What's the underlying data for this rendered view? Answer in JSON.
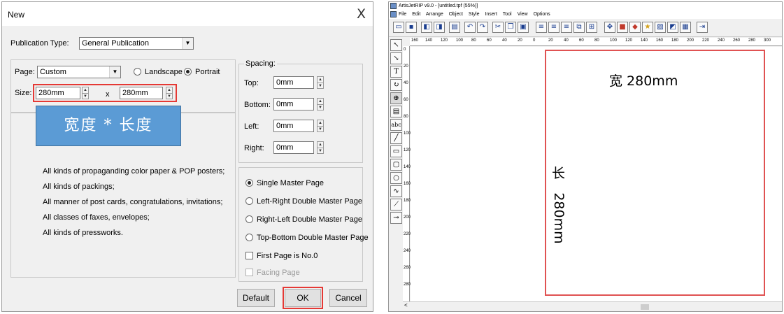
{
  "dialog": {
    "title": "New",
    "close_glyph": "X",
    "publication_type_label": "Publication Type:",
    "publication_type_value": "General Publication",
    "page_label": "Page:",
    "page_value": "Custom",
    "landscape_label": "Landscape",
    "portrait_label": "Portrait",
    "orientation_selected": "Portrait",
    "size_label": "Size:",
    "width_value": "280mm",
    "times": "x",
    "height_value": "280mm",
    "annotation": "宽度 * 长度",
    "spacing_title": "Spacing:",
    "spacing": [
      {
        "label": "Top:",
        "value": "0mm"
      },
      {
        "label": "Bottom:",
        "value": "0mm"
      },
      {
        "label": "Left:",
        "value": "0mm"
      },
      {
        "label": "Right:",
        "value": "0mm"
      }
    ],
    "descriptions": [
      "All kinds of propaganding color paper & POP posters;",
      "All kinds of packings;",
      "All manner of post cards, congratulations, invitations;",
      "All classes of faxes, envelopes;",
      "All kinds of pressworks."
    ],
    "master_options": [
      "Single Master Page",
      "Left-Right Double Master Page",
      "Right-Left Double Master Page",
      "Top-Bottom Double Master Page"
    ],
    "master_selected": "Single Master Page",
    "first_page_label": "First Page is No.0",
    "facing_page_label": "Facing Page",
    "default_button": "Default",
    "ok_button": "OK",
    "cancel_button": "Cancel",
    "highlight_color": "#e53935",
    "annotation_color": "#5b9bd5"
  },
  "app": {
    "title": "ArtisJetRIP v9.0 - [untitled.tpf (55%)]",
    "menu": [
      "File",
      "Edit",
      "Arrange",
      "Object",
      "Style",
      "Insert",
      "Tool",
      "View",
      "Options"
    ],
    "ruler_h": [
      "160",
      "140",
      "120",
      "100",
      "80",
      "60",
      "40",
      "20",
      "0",
      "20",
      "40",
      "60",
      "80",
      "100",
      "120",
      "140",
      "160",
      "180",
      "200",
      "220",
      "240",
      "260",
      "280",
      "300"
    ],
    "ruler_v": [
      "0",
      "20",
      "40",
      "60",
      "80",
      "100",
      "120",
      "140",
      "160",
      "180",
      "200",
      "220",
      "240",
      "260",
      "280"
    ],
    "width_note": "宽  280mm",
    "height_note_cn": "长",
    "height_note_mm": "280mm",
    "scroll_left": "<",
    "page_border_color": "#e05252"
  }
}
